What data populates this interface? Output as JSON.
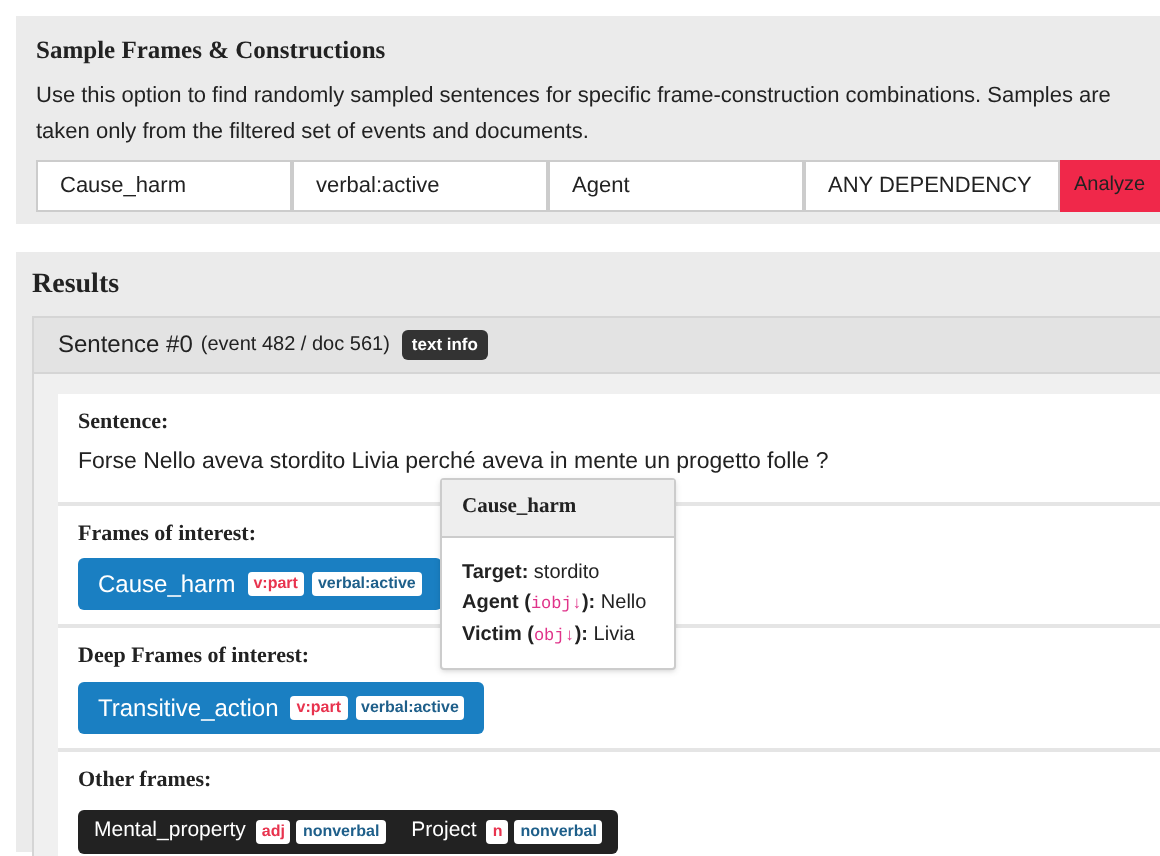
{
  "sample_panel": {
    "title": "Sample Frames & Constructions",
    "description": "Use this option to find randomly sampled sentences for specific frame-construction combinations. Samples are taken only from the filtered set of events and documents.",
    "fields": [
      "Cause_harm",
      "verbal:active",
      "Agent",
      "ANY DEPENDENCY"
    ],
    "button": "Analyze"
  },
  "results": {
    "title": "Results",
    "sentence": {
      "heading": "Sentence #0",
      "meta": "(event 482 / doc 561)",
      "badge": "text info",
      "label": "Sentence:",
      "text": "Forse Nello aveva stordito Livia perché aveva in mente un progetto folle ?",
      "sections": [
        {
          "label": "Frames of interest:",
          "kind": "interest",
          "frames": [
            {
              "name": "Cause_harm",
              "tags": [
                {
                  "text": "v:part",
                  "kind": "pos"
                },
                {
                  "text": "verbal:active",
                  "kind": "construction"
                }
              ]
            }
          ]
        },
        {
          "label": "Deep Frames of interest:",
          "kind": "interest",
          "frames": [
            {
              "name": "Transitive_action",
              "tags": [
                {
                  "text": "v:part",
                  "kind": "pos"
                },
                {
                  "text": "verbal:active",
                  "kind": "construction"
                }
              ]
            }
          ]
        },
        {
          "label": "Other frames:",
          "kind": "other",
          "frames": [
            {
              "name": "Mental_property",
              "tags": [
                {
                  "text": "adj",
                  "kind": "pos"
                },
                {
                  "text": "nonverbal",
                  "kind": "construction"
                }
              ]
            },
            {
              "name": "Project",
              "tags": [
                {
                  "text": "n",
                  "kind": "pos"
                },
                {
                  "text": "nonverbal",
                  "kind": "construction"
                }
              ]
            }
          ]
        }
      ]
    },
    "tooltip": {
      "title": "Cause_harm",
      "lines": [
        {
          "label": "Target:",
          "value": "stordito"
        },
        {
          "label": "Agent (",
          "code": "iobj↓",
          "close": "):",
          "value": "Nello"
        },
        {
          "label": "Victim (",
          "code": "obj↓",
          "close": "):",
          "value": "Livia"
        }
      ]
    }
  }
}
